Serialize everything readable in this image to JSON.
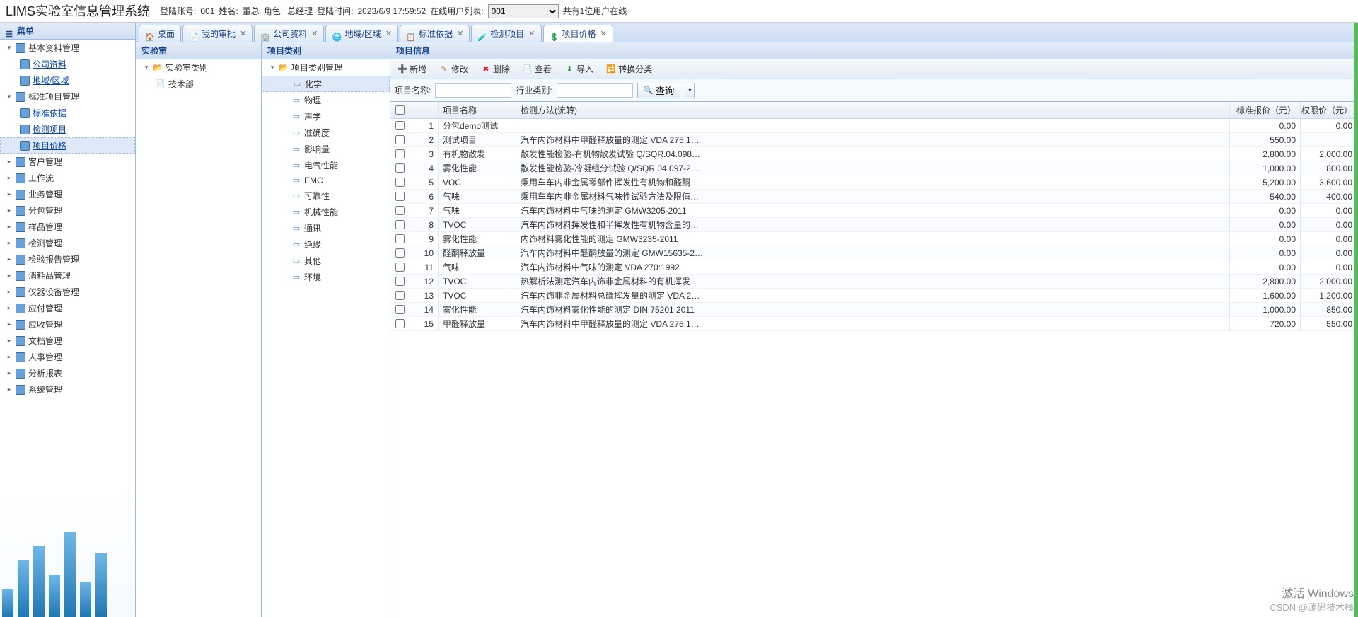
{
  "app": {
    "title": "LIMS实验室信息管理系统"
  },
  "header": {
    "login_label": "登陆账号:",
    "login_account": "001",
    "name_label": "姓名:",
    "name_value": "董总",
    "role_label": "角色:",
    "role_value": "总经理",
    "time_label": "登陆时间:",
    "time_value": "2023/6/9 17:59:52",
    "online_label": "在线用户列表:",
    "online_selected": "001",
    "online_count": "共有1位用户在线"
  },
  "sidebar": {
    "title": "菜单",
    "groups": [
      {
        "label": "基本资料管理",
        "expanded": true,
        "children": [
          {
            "label": "公司资料",
            "link": true
          },
          {
            "label": "地域/区域",
            "link": true
          }
        ]
      },
      {
        "label": "标准项目管理",
        "expanded": true,
        "children": [
          {
            "label": "标准依据",
            "link": true
          },
          {
            "label": "检测项目",
            "link": true
          },
          {
            "label": "项目价格",
            "link": true,
            "active": true
          }
        ]
      },
      {
        "label": "客户管理"
      },
      {
        "label": "工作流"
      },
      {
        "label": "业务管理"
      },
      {
        "label": "分包管理"
      },
      {
        "label": "样品管理"
      },
      {
        "label": "检测管理"
      },
      {
        "label": "检验报告管理"
      },
      {
        "label": "消耗品管理"
      },
      {
        "label": "仪器设备管理"
      },
      {
        "label": "应付管理"
      },
      {
        "label": "应收管理"
      },
      {
        "label": "文档管理"
      },
      {
        "label": "人事管理"
      },
      {
        "label": "分析报表"
      },
      {
        "label": "系统管理"
      }
    ]
  },
  "tabs": [
    {
      "label": "桌面",
      "icon": "home",
      "closable": false
    },
    {
      "label": "我的审批",
      "icon": "doc",
      "closable": true
    },
    {
      "label": "公司资料",
      "icon": "company",
      "closable": true
    },
    {
      "label": "地域/区域",
      "icon": "region",
      "closable": true
    },
    {
      "label": "标准依据",
      "icon": "standard",
      "closable": true
    },
    {
      "label": "检测项目",
      "icon": "test",
      "closable": true
    },
    {
      "label": "项目价格",
      "icon": "price",
      "closable": true,
      "active": true
    }
  ],
  "lab_panel": {
    "title": "实验室",
    "tree_root": "实验室类别",
    "tree_children": [
      "技术部"
    ]
  },
  "category_panel": {
    "title": "项目类别",
    "tree_root": "项目类别管理",
    "items": [
      "化学",
      "物理",
      "声学",
      "准确度",
      "影响量",
      "电气性能",
      "EMC",
      "可靠性",
      "机械性能",
      "通讯",
      "绝缘",
      "其他",
      "环境"
    ],
    "selected": 0
  },
  "info_panel": {
    "title": "项目信息",
    "toolbar": {
      "new": "新增",
      "edit": "修改",
      "delete": "删除",
      "view": "查看",
      "import": "导入",
      "convert": "转换分类"
    },
    "filter": {
      "name_label": "项目名称:",
      "name_value": "",
      "industry_label": "行业类别:",
      "industry_value": "",
      "query": "查询"
    },
    "columns": {
      "name": "项目名称",
      "method": "检测方法(流转)",
      "price": "标准报价（元）",
      "limit": "权限价（元）"
    },
    "rows": [
      {
        "n": 1,
        "name": "分包demo测试",
        "method": "",
        "price": "0.00",
        "limit": "0.00"
      },
      {
        "n": 2,
        "name": "测试项目",
        "method": "汽车内饰材料中甲醛释放量的测定 VDA 275:1…",
        "price": "550.00",
        "limit": ""
      },
      {
        "n": 3,
        "name": "有机物散发",
        "method": "散发性能检验-有机物散发试验 Q/SQR.04.098…",
        "price": "2,800.00",
        "limit": "2,000.00"
      },
      {
        "n": 4,
        "name": "雾化性能",
        "method": "散发性能检验-冷凝组分试验 Q/SQR.04.097-2…",
        "price": "1,000.00",
        "limit": "800.00"
      },
      {
        "n": 5,
        "name": "VOC",
        "method": "乘用车车内非金属零部件挥发性有机物和醛酮…",
        "price": "5,200.00",
        "limit": "3,600.00"
      },
      {
        "n": 6,
        "name": "气味",
        "method": "乘用车车内非金属材料气味性试验方法及限值…",
        "price": "540.00",
        "limit": "400.00"
      },
      {
        "n": 7,
        "name": "气味",
        "method": "汽车内饰材料中气味的测定 GMW3205-2011",
        "price": "0.00",
        "limit": "0.00"
      },
      {
        "n": 8,
        "name": "TVOC",
        "method": "汽车内饰材料挥发性和半挥发性有机物含量的…",
        "price": "0.00",
        "limit": "0.00"
      },
      {
        "n": 9,
        "name": "雾化性能",
        "method": "内饰材料雾化性能的测定 GMW3235-2011",
        "price": "0.00",
        "limit": "0.00"
      },
      {
        "n": 10,
        "name": "醛酮释放量",
        "method": "汽车内饰材料中醛酮放量的测定 GMW15635-2…",
        "price": "0.00",
        "limit": "0.00"
      },
      {
        "n": 11,
        "name": "气味",
        "method": "汽车内饰材料中气味的测定 VDA 270:1992",
        "price": "0.00",
        "limit": "0.00"
      },
      {
        "n": 12,
        "name": "TVOC",
        "method": "热解析法测定汽车内饰非金属材料的有机挥发…",
        "price": "2,800.00",
        "limit": "2,000.00"
      },
      {
        "n": 13,
        "name": "TVOC",
        "method": "汽车内饰非金属材料总碳挥发量的测定 VDA 2…",
        "price": "1,600.00",
        "limit": "1,200.00"
      },
      {
        "n": 14,
        "name": "雾化性能",
        "method": "汽车内饰材料雾化性能的测定 DIN 75201:2011",
        "price": "1,000.00",
        "limit": "850.00"
      },
      {
        "n": 15,
        "name": "甲醛释放量",
        "method": "汽车内饰材料中甲醛释放量的测定 VDA 275:1…",
        "price": "720.00",
        "limit": "550.00"
      }
    ]
  },
  "watermark": {
    "line1": "激活 Windows",
    "line2": "CSDN @源码技术栈"
  }
}
